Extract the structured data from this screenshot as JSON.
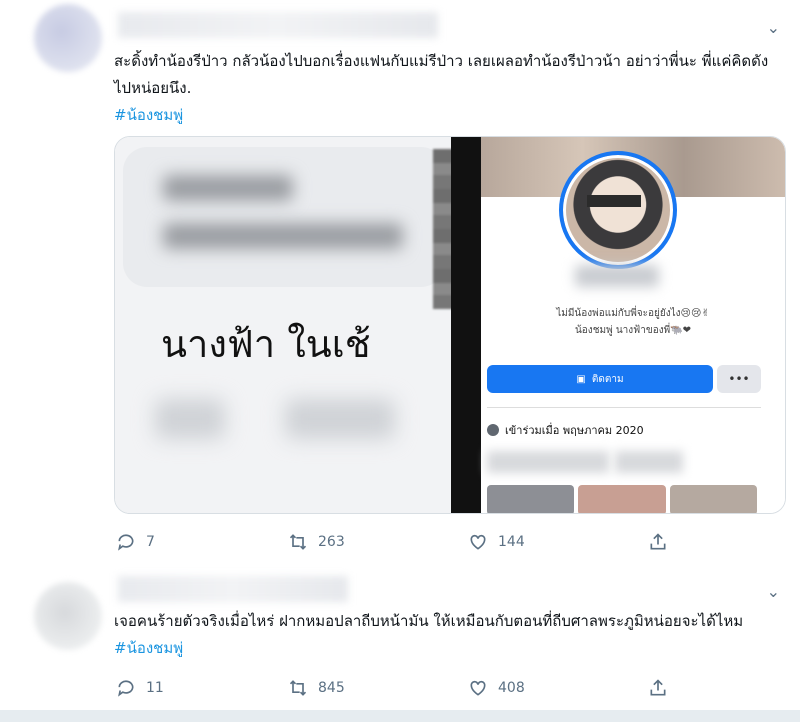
{
  "tweets": [
    {
      "text": "สะดิ้งทำน้องรีป่าว กลัวน้องไปบอกเรื่องแฟนกับแม่รีป่าว เลยเผลอทำน้องรีป่าวน้า อย่าว่าพี่นะ พี่แค่คิดดังไปหน่อยนึง.",
      "hashtag": "#น้องชมพู่",
      "media": {
        "left_caption": "นางฟ้า ในเช้",
        "profile": {
          "bio_line1": "ไม่มีน้องพ่อแม่กับพี่จะอยู่ยังไง😢😢✌",
          "bio_line2": "น้องชมพู่ นางฟ้าของพี่🐃❤",
          "follow_label": "ติดตาม",
          "more_label": "•••",
          "joined_text": "เข้าร่วมเมื่อ พฤษภาคม 2020"
        }
      },
      "replies": "7",
      "retweets": "263",
      "likes": "144"
    },
    {
      "text": "เจอคนร้ายตัวจริงเมื่อไหร่ ฝากหมอปลาถีบหน้ามัน ให้เหมือนกับตอนที่ถีบศาลพระภูมิหน่อยจะได้ไหม",
      "hashtag": "#น้องชมพู่",
      "replies": "11",
      "retweets": "845",
      "likes": "408"
    }
  ],
  "icons": {
    "chevron": "chevron-down-icon",
    "reply": "reply-icon",
    "retweet": "retweet-icon",
    "like": "heart-icon",
    "share": "share-icon"
  },
  "colors": {
    "hashtag": "#1b95e0",
    "follow_button": "#1877f2",
    "muted": "#5b7083"
  }
}
